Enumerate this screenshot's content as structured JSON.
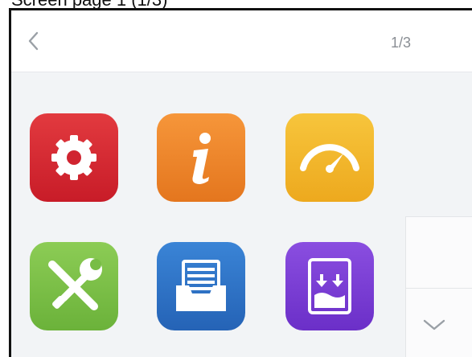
{
  "caption": "Screen page 1 (1/3)",
  "header": {
    "back_icon": "chevron-left-icon",
    "pager": "1/3"
  },
  "apps": [
    {
      "icon": "settings-gear-icon",
      "color": "#d8232f"
    },
    {
      "icon": "info-icon",
      "color": "#f0872a"
    },
    {
      "icon": "speedometer-icon",
      "color": "#f3b62a"
    },
    {
      "icon": "tools-icon",
      "color": "#7cc14a"
    },
    {
      "icon": "inbox-tray-icon",
      "color": "#2f74c8"
    },
    {
      "icon": "storage-download-icon",
      "color": "#7b3fd6"
    }
  ],
  "side_panel": {
    "scroll_icon": "chevron-down-icon"
  }
}
